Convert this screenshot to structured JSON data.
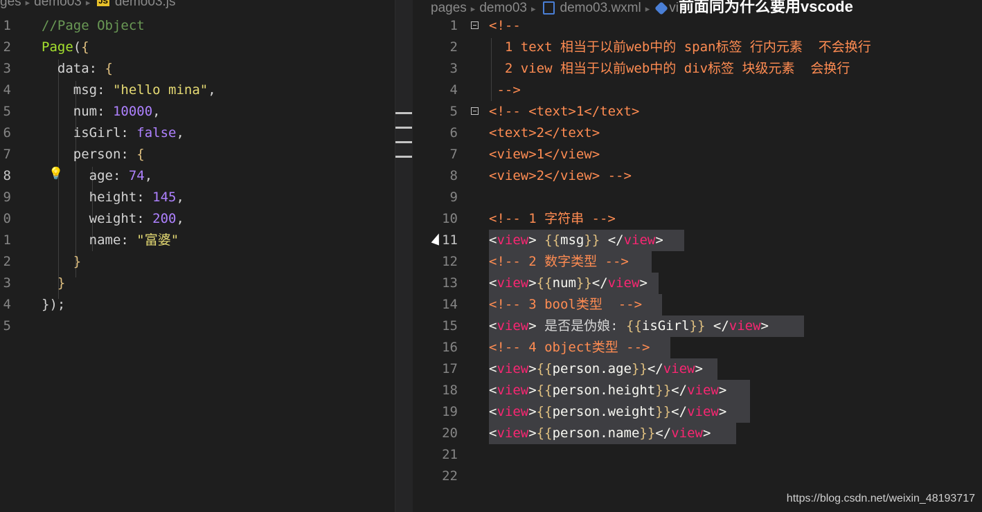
{
  "left_breadcrumb": {
    "folder1": "ges",
    "folder2": "demo03",
    "file_badge": "JS",
    "file": "demo03.js"
  },
  "right_breadcrumb": {
    "folder1": "pages",
    "folder2": "demo03",
    "file": "demo03.wxml",
    "extra": "vi",
    "overlay_title": "前面同为什么要用vscode"
  },
  "left_lines": [
    {
      "n": "1",
      "t": "//Page Object"
    },
    {
      "n": "2",
      "t": "Page({"
    },
    {
      "n": "3",
      "t": "  data: {"
    },
    {
      "n": "4",
      "t": "    msg: \"hello mina\","
    },
    {
      "n": "5",
      "t": "    num: 10000,"
    },
    {
      "n": "6",
      "t": "    isGirl: false,"
    },
    {
      "n": "7",
      "t": "    person: {"
    },
    {
      "n": "8",
      "t": "      age: 74,"
    },
    {
      "n": "9",
      "t": "      height: 145,"
    },
    {
      "n": "0",
      "t": "      weight: 200,"
    },
    {
      "n": "1",
      "t": "      name: \"富婆\""
    },
    {
      "n": "2",
      "t": "    }"
    },
    {
      "n": "3",
      "t": "  }"
    },
    {
      "n": "4",
      "t": "});"
    },
    {
      "n": "5",
      "t": ""
    }
  ],
  "right_lines": [
    {
      "n": "1",
      "t": "<!--"
    },
    {
      "n": "2",
      "t": "  1 text 相当于以前web中的 span标签 行内元素  不会换行"
    },
    {
      "n": "3",
      "t": "  2 view 相当于以前web中的 div标签 块级元素  会换行"
    },
    {
      "n": "4",
      "t": " -->"
    },
    {
      "n": "5",
      "t": "<!-- <text>1</text>"
    },
    {
      "n": "6",
      "t": "<text>2</text>"
    },
    {
      "n": "7",
      "t": "<view>1</view>"
    },
    {
      "n": "8",
      "t": "<view>2</view> -->"
    },
    {
      "n": "9",
      "t": ""
    },
    {
      "n": "10",
      "t": "<!-- 1 字符串 -->"
    },
    {
      "n": "11",
      "t": "<view> {{msg}} </view>"
    },
    {
      "n": "12",
      "t": "<!-- 2 数字类型 -->"
    },
    {
      "n": "13",
      "t": "<view>{{num}}</view>"
    },
    {
      "n": "14",
      "t": "<!-- 3 bool类型  -->"
    },
    {
      "n": "15",
      "t": "<view> 是否是伪娘: {{isGirl}} </view>"
    },
    {
      "n": "16",
      "t": "<!-- 4 object类型 -->"
    },
    {
      "n": "17",
      "t": "<view>{{person.age}}</view>"
    },
    {
      "n": "18",
      "t": "<view>{{person.height}}</view>"
    },
    {
      "n": "19",
      "t": "<view>{{person.weight}}</view>"
    },
    {
      "n": "20",
      "t": "<view>{{person.name}}</view>"
    },
    {
      "n": "21",
      "t": ""
    },
    {
      "n": "22",
      "t": ""
    }
  ],
  "watermark": "https://blog.csdn.net/weixin_48193717",
  "icons": {
    "lightbulb": "lightbulb-icon",
    "fold": "fold-toggle-icon",
    "cursor": "mouse-cursor-icon"
  }
}
